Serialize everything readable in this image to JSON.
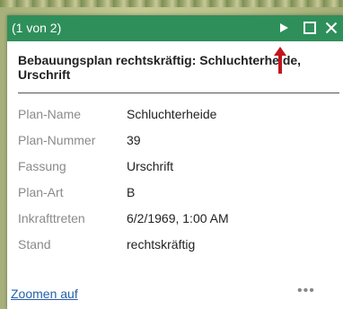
{
  "popup": {
    "header_title": "(1 von 2)",
    "title": "Bebauungsplan rechtskräftig: Schluchterheide, Urschrift",
    "fields": [
      {
        "label": "Plan-Name",
        "value": "Schluchterheide"
      },
      {
        "label": "Plan-Nummer",
        "value": "39"
      },
      {
        "label": "Fassung",
        "value": "Urschrift"
      },
      {
        "label": "Plan-Art",
        "value": "B"
      },
      {
        "label": "Inkrafttreten",
        "value": "6/2/1969, 1:00 AM"
      },
      {
        "label": "Stand",
        "value": "rechtskräftig"
      }
    ],
    "zoom_link": "Zoomen auf",
    "more_label": "•••"
  },
  "icons": {
    "next": "play-triangle-icon",
    "maximize": "maximize-square-icon",
    "close": "close-x-icon",
    "annotation": "red-arrow-up-icon"
  },
  "colors": {
    "header_bg": "#2f8f5b",
    "link": "#2560a9",
    "annotation_arrow": "#c0161d"
  }
}
